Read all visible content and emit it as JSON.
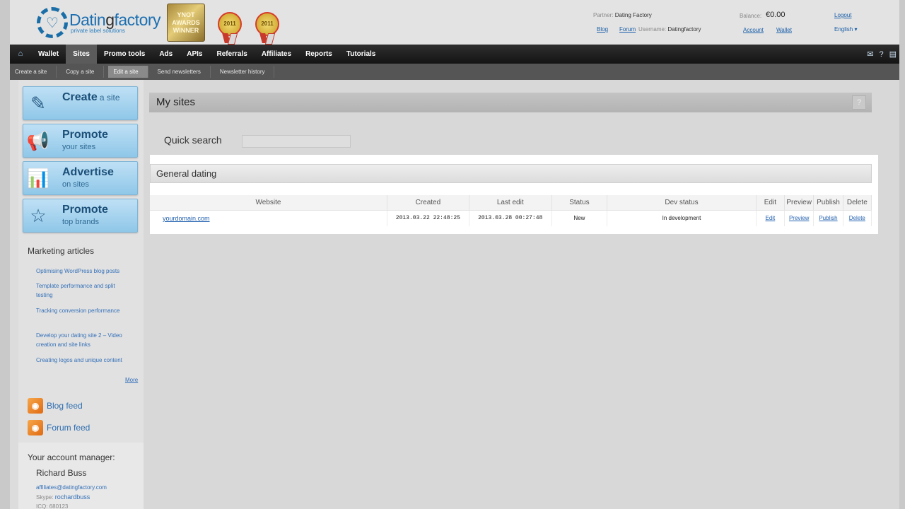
{
  "brand": {
    "name_part1": "Datin",
    "name_part2": "g",
    "name_part3": "factory",
    "tagline": "private label solutions",
    "award_text": "YNOT AWARDS WINNER",
    "medal_year": "2011"
  },
  "header": {
    "partner_label": "Partner:",
    "partner_value": "Dating Factory",
    "blog_link": "Blog",
    "forum_link": "Forum",
    "username_label": "Username:",
    "username_value": "Datingfactory",
    "balance_label": "Balance:",
    "balance_value": "€0.00",
    "account_link": "Account",
    "wallet_link": "Wallet",
    "logout_link": "Logout",
    "language": "English"
  },
  "main_nav": {
    "items": [
      "Wallet",
      "Sites",
      "Promo tools",
      "Ads",
      "APIs",
      "Referrals",
      "Affiliates",
      "Reports",
      "Tutorials"
    ],
    "active": "Sites"
  },
  "sub_nav": {
    "items": [
      "Create a site",
      "Copy a site",
      "Edit a site",
      "Send newsletters",
      "Newsletter history"
    ],
    "active": "Edit a site"
  },
  "sidebar": {
    "buttons": [
      {
        "big": "Create",
        "inline": "a site",
        "small": ""
      },
      {
        "big": "Promote",
        "inline": "",
        "small": "your sites"
      },
      {
        "big": "Advertise",
        "inline": "",
        "small": "on sites"
      },
      {
        "big": "Promote",
        "inline": "",
        "small": "top brands"
      }
    ],
    "marketing_title": "Marketing articles",
    "articles": [
      "Optimising WordPress blog posts",
      "Template performance and split testing",
      "Tracking conversion performance",
      "Develop your dating site 2 – Video creation and site links",
      "Creating logos and unique content"
    ],
    "more_link": "More",
    "blog_feed": "Blog feed",
    "forum_feed": "Forum feed",
    "account_manager_title": "Your account manager:",
    "account_manager_name": "Richard Buss",
    "account_manager_email": "affiliates@datingfactory.com",
    "skype_label": "Skype:",
    "skype_value": "rochardbuss",
    "icq": "ICQ: 680123"
  },
  "main": {
    "title": "My sites",
    "help": "?",
    "quick_search_label": "Quick search",
    "quick_search_value": "",
    "group_title": "General dating",
    "columns": [
      "Website",
      "Created",
      "Last edit",
      "Status",
      "Dev status",
      "Edit",
      "Preview",
      "Publish",
      "Delete"
    ],
    "rows": [
      {
        "website": "yourdomain.com",
        "created": "2013.03.22 22:48:25",
        "last_edit": "2013.03.28 00:27:48",
        "status": "New",
        "dev_status": "In development",
        "edit": "Edit",
        "preview": "Preview",
        "publish": "Publish",
        "delete": "Delete"
      }
    ]
  }
}
